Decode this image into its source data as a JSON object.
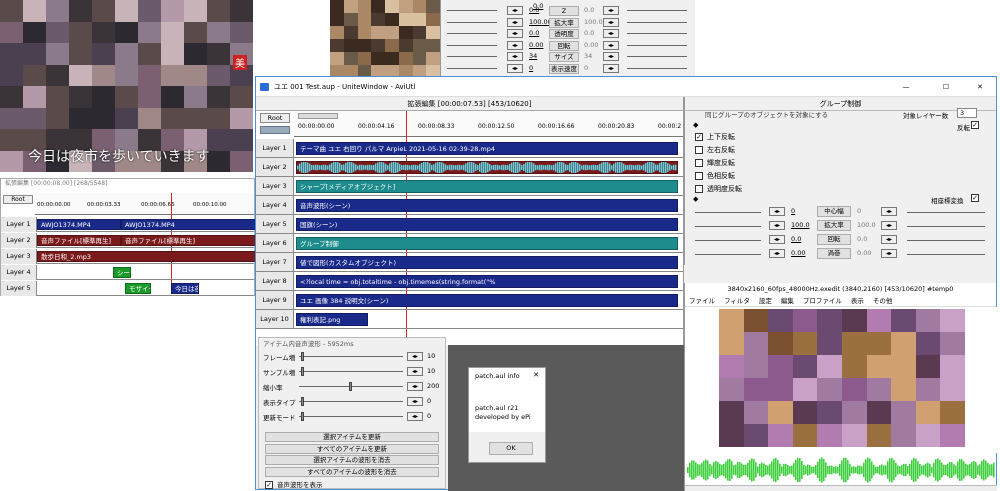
{
  "top_left_video": {
    "caption": "今日は夜市を歩いていきます",
    "sign": "美"
  },
  "small_timeline": {
    "title": "拡張編集 [00:00:08.00] [268/5548]",
    "root_label": "Root",
    "ruler": [
      "00:00:00.00",
      "00:00:03.33",
      "00:00:06.66",
      "00:00:10.00"
    ],
    "layers": [
      "Layer 1",
      "Layer 2",
      "Layer 3",
      "Layer 4",
      "Layer 5"
    ],
    "clips": {
      "l1a": "AWJO1374.MP4",
      "l1b": "AWJO1374.MP4",
      "l2a": "音声ファイル[標準再生]",
      "l2b": "音声ファイル[標準再生]",
      "l3": "散歩日和_2.mp3",
      "l4": "シーン",
      "l5a": "モザイク",
      "l5b": "今日は夜"
    }
  },
  "top_props": {
    "values_left": [
      "0.0",
      "0.0",
      "100.00",
      "0.0",
      "0.00",
      "34",
      "0"
    ],
    "labels": [
      "Z",
      "拡大率",
      "透明度",
      "回転",
      "サイズ",
      "表示速度"
    ],
    "values_right": [
      "0.0",
      "100.00",
      "0.0",
      "0.00",
      "34",
      "0"
    ]
  },
  "main_window": {
    "title": "ユエ 001 Test.aup - UniteWindow - AviUtl",
    "controls": {
      "min": "—",
      "max": "☐",
      "close": "✕"
    },
    "ext_title": "拡張編集 [00:00:07.53] [453/10620]",
    "root_label": "Root",
    "ruler": [
      "00:00:00.00",
      "00:00:04.16",
      "00:00:08.33",
      "00:00:12.50",
      "00:00:16.66",
      "00:00:20.83",
      "00:00:2"
    ],
    "layers": [
      "Layer 1",
      "Layer 2",
      "Layer 3",
      "Layer 4",
      "Layer 5",
      "Layer 6",
      "Layer 7",
      "Layer 8",
      "Layer 9",
      "Layer 10"
    ],
    "clips": [
      "テーマ曲 ユエ 右回り パルマ ArpieL 2021-05-16 02-39-28.mp4",
      "",
      "シャープ[メディアオブジェクト]",
      "音声波形(シーン)",
      "国旗(シーン)",
      "グループ制御",
      "値で図形(カスタムオブジェクト)",
      "<?local time = obj.totaltime - obj.timemes(string.format(\"%",
      "ユエ 画像 384 説明文(シーン)",
      "権利表記.png"
    ]
  },
  "group_panel": {
    "title": "グループ制御",
    "top_text": "同じグループのオブジェクトを対象にする",
    "target_label": "対象レイヤー数",
    "target_value": "3",
    "invert_label": "反転",
    "checks": [
      {
        "label": "上下反転",
        "checked": true
      },
      {
        "label": "左右反転",
        "checked": false
      },
      {
        "label": "輝度反転",
        "checked": false
      },
      {
        "label": "色相反転",
        "checked": false
      },
      {
        "label": "透明度反転",
        "checked": false
      }
    ],
    "coord_label": "相座標変換",
    "params": [
      {
        "left": "0",
        "label": "中心幅",
        "right": "0"
      },
      {
        "left": "100.0",
        "label": "拡大率",
        "right": "100.0"
      },
      {
        "left": "0.0",
        "label": "回転",
        "right": "0.0"
      },
      {
        "left": "0.00",
        "label": "渦巻",
        "right": "0.00"
      }
    ]
  },
  "preview": {
    "title": "3840x2160_60fps_48000Hz.exedit (3840,2160) [453/10620] #temp0",
    "menu": [
      "ファイル",
      "フィルタ",
      "設定",
      "編集",
      "プロファイル",
      "表示",
      "その他"
    ]
  },
  "waveform_dialog": {
    "title": "アイテム内音声波形 - 5952ms",
    "rows": [
      {
        "label": "フレーム増",
        "value": "10"
      },
      {
        "label": "サンプル増",
        "value": "10"
      },
      {
        "label": "縮小率",
        "value": "200"
      },
      {
        "label": "表示タイプ",
        "value": "0"
      },
      {
        "label": "更新モード",
        "value": "0"
      }
    ],
    "buttons": [
      "選択アイテムを更新",
      "すべてのアイテムを更新",
      "選択アイテムの波形を消去",
      "すべてのアイテムの波形を消去"
    ],
    "checkbox_label": "音声波形を表示"
  },
  "info_dialog": {
    "title": "patch.aul info",
    "close": "✕",
    "line1": "patch.aul r21",
    "line2": "developed by ePi",
    "ok": "OK"
  },
  "colors": {
    "navy": "#1a2a8a",
    "teal": "#1e8c8c",
    "darkred": "#7a1a1a",
    "green": "#1b9a2a",
    "wave": "#3ecf3e"
  }
}
